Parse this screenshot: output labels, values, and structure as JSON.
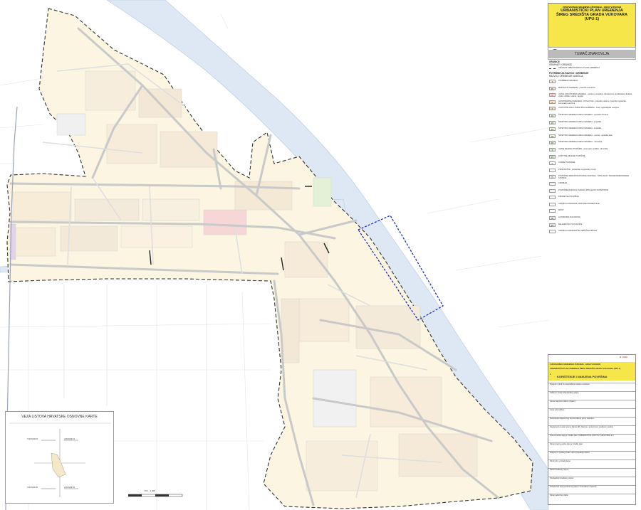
{
  "title_block": {
    "line1": "VUKOVARSKO-SRIJEMSKA ŽUPANIJA - GRAD VUKOVAR",
    "line2": "URBANISTIČKI PLAN UREĐENJA",
    "line3": "ŠIREG SREDIŠTA GRADA VUKOVARA",
    "line4": "(UPU-1)",
    "institute": "ZAVOD ZA PROSTORNO PLANIRANJE ARHITEKTONSKI FAKULTET SVEUČILIŠTA U ZAGREBU",
    "logo_text": "UH",
    "institute2": "ZAVOD ZA URBANIZAM"
  },
  "legend": {
    "title": "TUMAČ ZNAKOVLJA",
    "section_borders": "GRANICE",
    "border_sub": "OBUHVAT I GRANICE",
    "border_item": "OBUHVAT URBANISTIČKOG PLANA UREĐENJA",
    "section_use": "POVRŠINE ZA RAZVOJ I UREĐENJE",
    "use_sub": "RAZVOJ I UREĐENJE NASELJA",
    "items": [
      {
        "code": "S",
        "color": "#fbf3d6",
        "label": "STAMBENA NAMJENA"
      },
      {
        "code": "M1",
        "color": "#f8e6c4",
        "label": "MJEŠOVITA NAMJENA - pretežito stambena"
      },
      {
        "code": "D",
        "color": "#f5d6d6",
        "label": "JAVNA I DRUŠTVENA NAMJENA - upravna, socijalna, zdravstvena, predškolska, školska, visoko učilište, kultura, vjerska"
      },
      {
        "code": "K",
        "color": "#fde2c8",
        "label": "GOSPODARSKA NAMJENA - POSLOVNA - pretežito uslužna, pretežito trgovačka, komunalno-servisna"
      },
      {
        "code": "T",
        "color": "#f9d9b8",
        "label": "UGOSTITELJSKO-TURISTIČKA NAMJENA - hotel, ugostiteljska namjena"
      },
      {
        "code": "R1",
        "color": "#e3f2d6",
        "label": "ŠPORTSKO-REKREACIJSKA NAMJENA - sportska dvorana"
      },
      {
        "code": "R2",
        "color": "#e8f4dd",
        "label": "ŠPORTSKO-REKREACIJSKA NAMJENA - kupalište"
      },
      {
        "code": "R3",
        "color": "#eef7e5",
        "label": "ŠPORTSKO-REKREACIJSKA NAMJENA - kupalište"
      },
      {
        "code": "R4",
        "color": "#e6f3dd",
        "label": "ŠPORTSKO-REKREACIJSKA NAMJENA - marina - sportska luka"
      },
      {
        "code": "R5",
        "color": "#dff0d2",
        "label": "ŠPORTSKO-REKREACIJSKA NAMJENA - rekreacija"
      },
      {
        "code": "Z",
        "color": "#d9edc9",
        "label": "JAVNE ZELENE POVRŠINE - javni park, igralište, odmorište"
      },
      {
        "code": "Z1",
        "color": "#d4ebc2",
        "label": "ZAŠTITNE ZELENE POVRŠINE"
      },
      {
        "code": "V",
        "color": "#ffffff",
        "label": "VODNE POVRŠINE"
      },
      {
        "code": "",
        "color": "#ffffff",
        "label": "PRISTANIŠTE - pristanište za putnički promet"
      },
      {
        "code": "IS",
        "color": "#eeeeee",
        "label": "POVRŠINE INFRASTRUKTURNIH SUSTAVA - TRPLJANJI I TRANSFORMATORSKE STANICE"
      },
      {
        "code": "",
        "color": "#f0f0f0",
        "label": "GROBLJE"
      },
      {
        "code": "",
        "color": "#f2f2f2",
        "label": "POVRŠINE RAZVOJA VODNOG PROLAZA S POVRŠINOM"
      },
      {
        "code": "",
        "color": "#f7f7f7",
        "label": "PROMETNE POVRŠINE"
      },
      {
        "code": "",
        "color": "#ffffff",
        "label": "GRANICA KORIDORA OSNOVNE PROMETNICE"
      },
      {
        "code": "",
        "color": "#ffffff",
        "label": "MOST"
      },
      {
        "code": "AK",
        "color": "#e8e8e8",
        "label": "AUTOBUSNI KOLODVOR"
      },
      {
        "code": "ŽS",
        "color": "#e8e8e8",
        "label": "ŽELJEZNIČKO STAJALIŠTE"
      },
      {
        "code": "",
        "color": "#ffffff",
        "label": "GRANICA KORIDORA ŽELJEZNIČKE PRUGE"
      }
    ]
  },
  "key_map": {
    "title": "VEZA LISTOVA HRVATSKE OSNOVNE KARTE",
    "labels": [
      "VUKOVAR 18",
      "VUKOVAR 19",
      "VUKOVAR 28",
      "VUKOVAR 29"
    ]
  },
  "scale": {
    "label": "M 1 : 2 000"
  },
  "doc_table": {
    "page_code": "M 1:2000",
    "county": "VUKOVARSKO-SRIJEMSKA ŽUPANIJA - GRAD VUKOVAR",
    "plan_name": "URBANISTIČKI PLAN UREĐENJA ŠIREG SREDIŠTA GRADA VUKOVARA (UPU-1)",
    "sheet_no": "1.",
    "sheet_title": "KORIŠTENJE I NAMJENA POVRŠINA",
    "rows": [
      "Program mjera za unapređenje stanja u prostoru",
      "Odluka o izradi urbanističkog plana",
      "Javna rasprava (datum objave):",
      "Javni uvid održan:",
      "Pečat tijela odgovornog za provođenje javne rasprave:",
      "Suglasnost na plan prema članku 98. Zakona o prostornom uređenju i gradnji",
      "Pravna osoba koja je izradila plan: URBANISTIČKI INSTITUT HRVATSKE d.d.",
      "Pečat pravne osobe koja je izradila plan:",
      "Odgovorni voditelj izrade nacrta prijedloga plana:",
      "Stručni tim u izradi plana:",
      "Pečat Gradskog vijeća:",
      "Predsjednik Gradskog vijeća:",
      "Istovjetnost ovog prostornog plana s izvornikom ovjerava:",
      "Pečat nadležnog tijela:"
    ]
  }
}
